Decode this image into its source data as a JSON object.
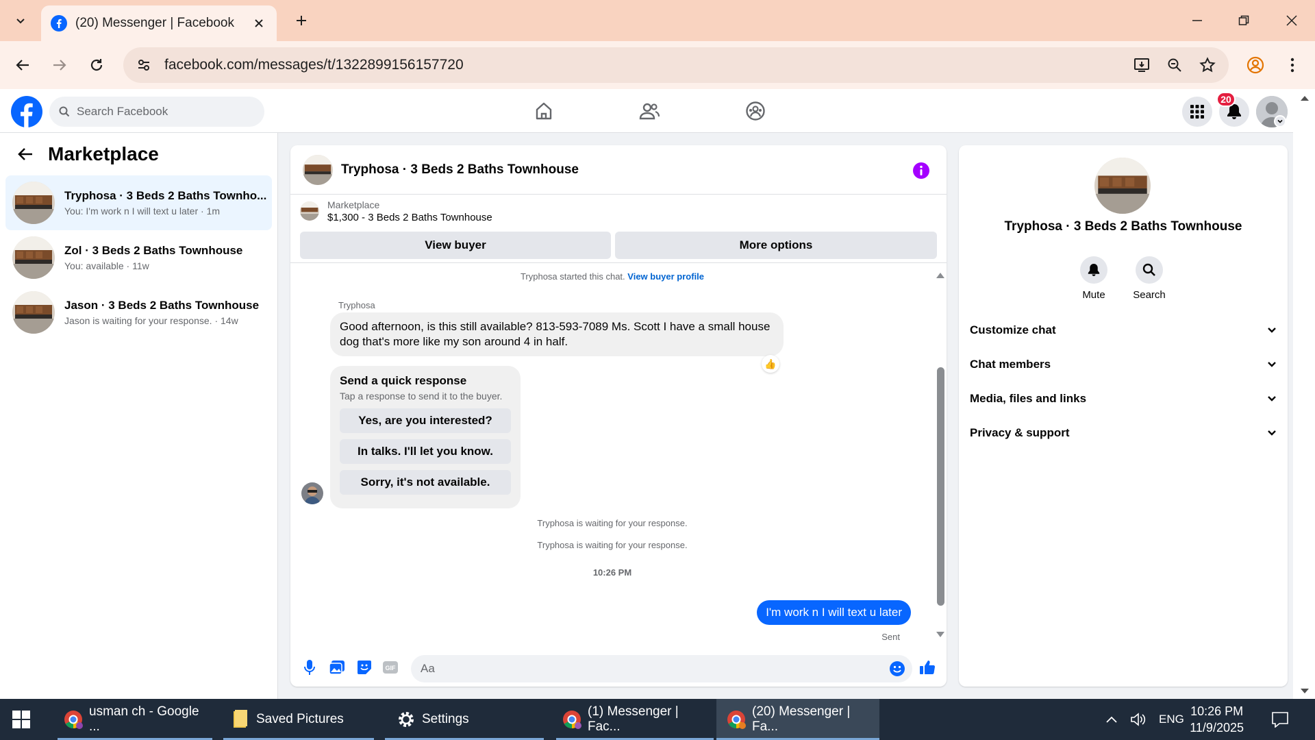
{
  "browser": {
    "tab_title": "(20) Messenger | Facebook",
    "url": "facebook.com/messages/t/1322899156157720"
  },
  "fb": {
    "search_placeholder": "Search Facebook",
    "notification_count": "20"
  },
  "sidebar": {
    "title": "Marketplace",
    "conversations": [
      {
        "name": "Tryphosa · 3 Beds 2 Baths Townho...",
        "snippet": "You: I'm work n I will text u later · 1m",
        "active": true
      },
      {
        "name": "Zol · 3 Beds 2 Baths Townhouse",
        "snippet": "You: available · 11w",
        "active": false
      },
      {
        "name": "Jason · 3 Beds 2 Baths Townhouse",
        "snippet": "Jason is waiting for your response. · 14w",
        "active": false
      }
    ]
  },
  "chat": {
    "title": "Tryphosa · 3 Beds 2 Baths Townhouse",
    "listing_label": "Marketplace",
    "listing_price": "$1,300 - 3 Beds 2 Baths Townhouse",
    "view_buyer": "View buyer",
    "more_options": "More options",
    "started_text": "Tryphosa started this chat.",
    "buyer_profile_link": "View buyer profile",
    "sender": "Tryphosa",
    "incoming_message": "Good afternoon, is this still available? 813-593-7089 Ms. Scott I have a small house dog that's more like my son around 4 in half.",
    "reaction": "👍",
    "quick_title": "Send a quick response",
    "quick_subtitle": "Tap a response to send it to the buyer.",
    "quick_responses": [
      "Yes, are you interested?",
      "In talks. I'll let you know.",
      "Sorry, it's not available."
    ],
    "waiting_1": "Tryphosa is waiting for your response.",
    "waiting_2": "Tryphosa is waiting for your response.",
    "timestamp": "10:26 PM",
    "outgoing_message": "I'm work n I will text u later",
    "status": "Sent",
    "input_placeholder": "Aa"
  },
  "info_panel": {
    "title": "Tryphosa · 3 Beds 2 Baths Townhouse",
    "mute": "Mute",
    "search": "Search",
    "sections": [
      "Customize chat",
      "Chat members",
      "Media, files and links",
      "Privacy & support"
    ]
  },
  "taskbar": {
    "items": [
      "usman ch - Google ...",
      "Saved Pictures",
      "Settings",
      "(1) Messenger | Fac...",
      "(20) Messenger | Fa..."
    ],
    "language": "ENG",
    "time": "10:26 PM",
    "date": "11/9/2025"
  },
  "colors": {
    "fb_blue": "#0866ff",
    "tab_bar": "#f9d3c0",
    "badge_red": "#e41e3f"
  }
}
